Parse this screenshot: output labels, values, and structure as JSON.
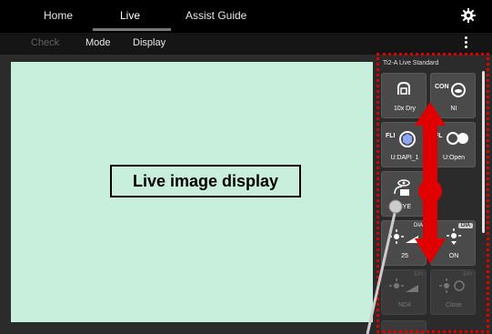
{
  "topbar": {
    "tabs": [
      {
        "label": "Home"
      },
      {
        "label": "Live"
      },
      {
        "label": "Assist Guide"
      }
    ],
    "active_tab": "Live",
    "settings_icon": "gear-icon"
  },
  "subbar": {
    "items": [
      {
        "label": "Check",
        "enabled": false
      },
      {
        "label": "Mode",
        "enabled": true
      },
      {
        "label": "Display",
        "enabled": true
      }
    ],
    "more_icon": "kebab-menu-icon"
  },
  "live": {
    "label": "Live image display"
  },
  "panel": {
    "title": "Ti2-A Live Standard",
    "highlight_color": "#e00000",
    "tiles": [
      {
        "icon": "objective-icon",
        "label": "10x Dry",
        "tag": "",
        "enabled": true
      },
      {
        "icon": "condenser-icon",
        "prefix": "CON",
        "label": "NI",
        "tag": "",
        "enabled": true
      },
      {
        "icon": "filter-cube-icon",
        "prefix": "FLI",
        "label": "U:DAPI_1",
        "tag": "",
        "enabled": true
      },
      {
        "icon": "shutter-icon",
        "prefix": "FL",
        "label": "U:Open",
        "tag": "",
        "enabled": true
      },
      {
        "icon": "light-path-icon",
        "label": "EYE",
        "tag": "",
        "enabled": true
      },
      {
        "icon": "blank",
        "label": "",
        "tag": "",
        "enabled": true
      },
      {
        "icon": "dia-intensity-icon",
        "label": "25",
        "tag": "DIA",
        "enabled": true
      },
      {
        "icon": "dia-lamp-icon",
        "label": "ON",
        "tag": "DIA",
        "enabled": true
      },
      {
        "icon": "epi-nd-icon",
        "label": "ND4",
        "tag": "EPI",
        "enabled": false
      },
      {
        "icon": "epi-shutter-icon",
        "label": "Close",
        "tag": "EPI",
        "enabled": false
      }
    ]
  },
  "annotation": {
    "arrow_color": "#e00000",
    "pointer_color": "#cccccc"
  }
}
